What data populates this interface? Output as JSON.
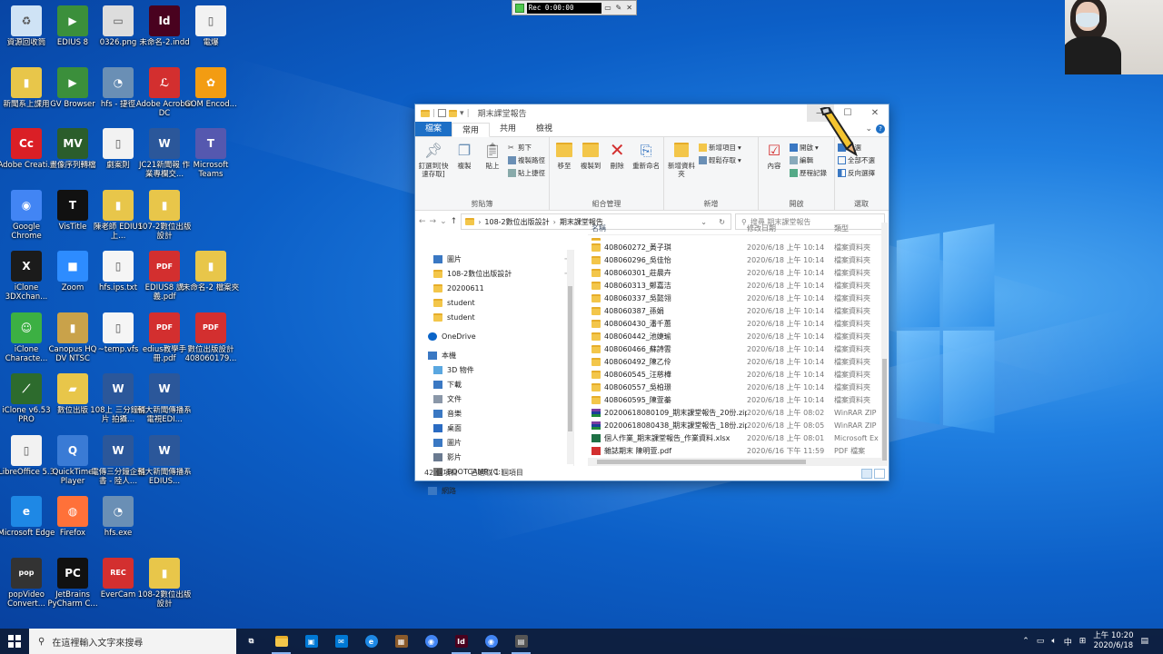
{
  "desktop": {
    "col1": [
      {
        "label": "資源回收筒",
        "icon": "recycle-bin-icon",
        "color": "#cfe3f5",
        "glyph": "♻"
      },
      {
        "label": "新聞系上課用",
        "icon": "folder-doc-icon",
        "color": "#e8c64a",
        "glyph": "▮"
      },
      {
        "label": "Adobe Creati...",
        "icon": "adobe-cc-icon",
        "color": "#da1f26",
        "glyph": "Cc"
      },
      {
        "label": "Google Chrome",
        "icon": "chrome-icon",
        "color": "#4285f4",
        "glyph": "◉"
      },
      {
        "label": "iClone 3DXchan...",
        "icon": "iclone-3dxchange-icon",
        "color": "#1b1b1b",
        "glyph": "X"
      },
      {
        "label": "iClone Characte...",
        "icon": "iclone-character-icon",
        "color": "#3cb043",
        "glyph": "☺"
      },
      {
        "label": "iClone v6.53 PRO",
        "icon": "iclone-pro-icon",
        "color": "#2d6b2d",
        "glyph": "⟋"
      },
      {
        "label": "LibreOffice 5.3",
        "icon": "libreoffice-icon",
        "color": "#f2f2f2",
        "glyph": "▯"
      },
      {
        "label": "Microsoft Edge",
        "icon": "edge-icon",
        "color": "#1e88e5",
        "glyph": "e"
      },
      {
        "label": "popVideo Convert...",
        "icon": "popvideo-icon",
        "color": "#333333",
        "glyph": "pop"
      }
    ],
    "col2": [
      {
        "label": "EDIUS 8",
        "icon": "edius-icon",
        "color": "#3b8f3b",
        "glyph": "▶"
      },
      {
        "label": "GV Browser",
        "icon": "gv-browser-icon",
        "color": "#3b8f3b",
        "glyph": "▶"
      },
      {
        "label": "畫像序列轉檔",
        "icon": "mv-converter-icon",
        "color": "#2b5d2b",
        "glyph": "MV"
      },
      {
        "label": "VisTitle",
        "icon": "vistitle-icon",
        "color": "#111111",
        "glyph": "T"
      },
      {
        "label": "Zoom",
        "icon": "zoom-icon",
        "color": "#2d8cff",
        "glyph": "■"
      },
      {
        "label": "Canopus HQ DV NTSC",
        "icon": "canopus-icon",
        "color": "#c9a24a",
        "glyph": "▮"
      },
      {
        "label": "數位出版",
        "icon": "folder-icon",
        "color": "#e8c64a",
        "glyph": "▰"
      },
      {
        "label": "QuickTime Player",
        "icon": "quicktime-icon",
        "color": "#3a7bd5",
        "glyph": "Q"
      },
      {
        "label": "Firefox",
        "icon": "firefox-icon",
        "color": "#ff7139",
        "glyph": "◍"
      },
      {
        "label": "JetBrains PyCharm C...",
        "icon": "pycharm-icon",
        "color": "#111111",
        "glyph": "PC"
      }
    ],
    "col3": [
      {
        "label": "0326.png",
        "icon": "image-file-icon",
        "color": "#dddddd",
        "glyph": "▭"
      },
      {
        "label": "hfs - 捷徑",
        "icon": "hfs-icon",
        "color": "#6a8fb5",
        "glyph": "◔"
      },
      {
        "label": "劇案則",
        "icon": "doc-file-icon",
        "color": "#f2f2f2",
        "glyph": "▯"
      },
      {
        "label": "陳老師 EDIUS 上...",
        "icon": "folder-doc-icon",
        "color": "#e8c64a",
        "glyph": "▮"
      },
      {
        "label": "hfs.ips.txt",
        "icon": "text-file-icon",
        "color": "#f5f5f5",
        "glyph": "▯"
      },
      {
        "label": "~temp.vfs",
        "icon": "blank-file-icon",
        "color": "#f5f5f5",
        "glyph": "▯"
      },
      {
        "label": "108上 三分鐘影片 拍攝...",
        "icon": "word-file-icon",
        "color": "#2b579a",
        "glyph": "W"
      },
      {
        "label": "電傳三分鐘企畫書 - 陸人...",
        "icon": "word-file-icon",
        "color": "#2b579a",
        "glyph": "W"
      },
      {
        "label": "hfs.exe",
        "icon": "hfs-exe-icon",
        "color": "#6a8fb5",
        "glyph": "◔"
      },
      {
        "label": "EverCam",
        "icon": "evercam-icon",
        "color": "#d32f2f",
        "glyph": "REC"
      }
    ],
    "col4": [
      {
        "label": "未命名-2.indd",
        "icon": "indesign-file-icon",
        "color": "#49021f",
        "glyph": "Id"
      },
      {
        "label": "Adobe Acrobat DC",
        "icon": "acrobat-icon",
        "color": "#d32f2f",
        "glyph": "ℒ"
      },
      {
        "label": "JC21新聞報 作業專欄交...",
        "icon": "word-file-icon",
        "color": "#2b579a",
        "glyph": "W"
      },
      {
        "label": "107-2數位出版設計",
        "icon": "folder-doc-icon",
        "color": "#e8c64a",
        "glyph": "▮"
      },
      {
        "label": "EDIUS8 講義.pdf",
        "icon": "pdf-file-icon",
        "color": "#d32f2f",
        "glyph": "PDF"
      },
      {
        "label": "edius教學手冊.pdf",
        "icon": "pdf-file-icon",
        "color": "#d32f2f",
        "glyph": "PDF"
      },
      {
        "label": "輔大新聞傳播系 電視EDI...",
        "icon": "word-file-icon",
        "color": "#2b579a",
        "glyph": "W"
      },
      {
        "label": "輔大新聞傳播系 EDIUS...",
        "icon": "word-file-icon",
        "color": "#2b579a",
        "glyph": "W"
      },
      {
        "label": "",
        "icon": "empty-slot",
        "color": "transparent",
        "glyph": ""
      },
      {
        "label": "108-2數位出版設計",
        "icon": "folder-doc-icon",
        "color": "#e8c64a",
        "glyph": "▮"
      }
    ],
    "col5": [
      {
        "label": "電爆",
        "icon": "doc-file-icon",
        "color": "#f2f2f2",
        "glyph": "▯"
      },
      {
        "label": "GOM Encod...",
        "icon": "gom-encoder-icon",
        "color": "#f39c12",
        "glyph": "✿"
      },
      {
        "label": "Microsoft Teams",
        "icon": "teams-icon",
        "color": "#5558af",
        "glyph": "T"
      },
      {
        "label": "",
        "icon": "empty-slot",
        "color": "transparent",
        "glyph": ""
      },
      {
        "label": "未命名-2 檔案夾",
        "icon": "folder-doc-icon",
        "color": "#e8c64a",
        "glyph": "▮"
      },
      {
        "label": "數位出版設計 408060179...",
        "icon": "pdf-file-icon",
        "color": "#d32f2f",
        "glyph": "PDF"
      }
    ]
  },
  "recorder": {
    "time": "Rec 0:00:00"
  },
  "explorer": {
    "title": "期末課堂報告",
    "tabs": {
      "file": "檔案",
      "home": "常用",
      "share": "共用",
      "view": "檢視"
    },
    "ribbon": {
      "pin": "釘選到[快速存取]",
      "copy": "複製",
      "paste": "貼上",
      "cut": "剪下",
      "copy_path": "複製路徑",
      "paste_shortcut": "貼上捷徑",
      "clipboard": "剪貼簿",
      "move_to": "移至",
      "copy_to": "複製到",
      "delete": "刪除",
      "rename": "重新命名",
      "organize": "組合管理",
      "new_folder": "新增資料夾",
      "new_item": "新增項目",
      "easy_access": "輕鬆存取",
      "new": "新增",
      "properties": "內容",
      "open": "開啟",
      "edit": "編輯",
      "history": "歷程記錄",
      "open_group": "開啟",
      "select_all": "全選",
      "select_none": "全部不選",
      "invert": "反向選擇",
      "select": "選取"
    },
    "address": {
      "seg1": "108-2數位出版設計",
      "seg2": "期末課堂報告",
      "search_placeholder": "搜尋 期末課堂報告"
    },
    "nav": [
      {
        "label": "圖片",
        "icon": "pictures-icon",
        "pin": true,
        "indent": 0
      },
      {
        "label": "108-2數位出版設計",
        "icon": "folder-icon",
        "pin": true,
        "indent": 0
      },
      {
        "label": "20200611",
        "icon": "folder-icon",
        "pin": false,
        "indent": 0
      },
      {
        "label": "student",
        "icon": "folder-icon",
        "pin": false,
        "indent": 0
      },
      {
        "label": "student",
        "icon": "folder-icon",
        "pin": false,
        "indent": 0
      },
      {
        "label": "",
        "icon": "spacer",
        "pin": false,
        "indent": 0
      },
      {
        "label": "OneDrive",
        "icon": "onedrive-icon",
        "pin": false,
        "indent": -1
      },
      {
        "label": "",
        "icon": "spacer",
        "pin": false,
        "indent": 0
      },
      {
        "label": "本機",
        "icon": "this-pc-icon",
        "pin": false,
        "indent": -1
      },
      {
        "label": "3D 物件",
        "icon": "3d-objects-icon",
        "pin": false,
        "indent": 0
      },
      {
        "label": "下載",
        "icon": "downloads-icon",
        "pin": false,
        "indent": 0
      },
      {
        "label": "文件",
        "icon": "documents-icon",
        "pin": false,
        "indent": 0
      },
      {
        "label": "音樂",
        "icon": "music-icon",
        "pin": false,
        "indent": 0
      },
      {
        "label": "桌面",
        "icon": "desktop-icon",
        "pin": false,
        "indent": 0
      },
      {
        "label": "圖片",
        "icon": "pictures-icon",
        "pin": false,
        "indent": 0
      },
      {
        "label": "影片",
        "icon": "videos-icon",
        "pin": false,
        "indent": 0
      },
      {
        "label": "BOOTCAMP (C:)",
        "icon": "drive-icon",
        "pin": false,
        "indent": 0
      },
      {
        "label": "",
        "icon": "spacer",
        "pin": false,
        "indent": 0
      },
      {
        "label": "網路",
        "icon": "network-icon",
        "pin": false,
        "indent": -1
      }
    ],
    "columns": {
      "name": "名稱",
      "date": "修改日期",
      "type": "類型"
    },
    "files": [
      {
        "name": "408060272_黃子琪",
        "date": "2020/6/18 上午 10:14",
        "type": "檔案資料夾",
        "kind": "folder"
      },
      {
        "name": "408060296_吳佳怡",
        "date": "2020/6/18 上午 10:14",
        "type": "檔案資料夾",
        "kind": "folder"
      },
      {
        "name": "408060301_莊晨卉",
        "date": "2020/6/18 上午 10:14",
        "type": "檔案資料夾",
        "kind": "folder"
      },
      {
        "name": "408060313_鄭嘉洁",
        "date": "2020/6/18 上午 10:14",
        "type": "檔案資料夾",
        "kind": "folder"
      },
      {
        "name": "408060337_吳懿翎",
        "date": "2020/6/18 上午 10:14",
        "type": "檔案資料夾",
        "kind": "folder"
      },
      {
        "name": "408060387_孫娟",
        "date": "2020/6/18 上午 10:14",
        "type": "檔案資料夾",
        "kind": "folder"
      },
      {
        "name": "408060430_潘千蕙",
        "date": "2020/6/18 上午 10:14",
        "type": "檔案資料夾",
        "kind": "folder"
      },
      {
        "name": "408060442_池婕瑜",
        "date": "2020/6/18 上午 10:14",
        "type": "檔案資料夾",
        "kind": "folder"
      },
      {
        "name": "408060466_蘇詩雲",
        "date": "2020/6/18 上午 10:14",
        "type": "檔案資料夾",
        "kind": "folder"
      },
      {
        "name": "408060492_陳乙伶",
        "date": "2020/6/18 上午 10:14",
        "type": "檔案資料夾",
        "kind": "folder"
      },
      {
        "name": "408060545_汪慈樺",
        "date": "2020/6/18 上午 10:14",
        "type": "檔案資料夾",
        "kind": "folder"
      },
      {
        "name": "408060557_吳柏璟",
        "date": "2020/6/18 上午 10:14",
        "type": "檔案資料夾",
        "kind": "folder"
      },
      {
        "name": "408060595_陳萱蓁",
        "date": "2020/6/18 上午 10:14",
        "type": "檔案資料夾",
        "kind": "folder"
      },
      {
        "name": "20200618080109_期末課堂報告_20份.zip",
        "date": "2020/6/18 上午 08:02",
        "type": "WinRAR ZIP",
        "kind": "zip"
      },
      {
        "name": "20200618080438_期末課堂報告_18份.zip",
        "date": "2020/6/18 上午 08:05",
        "type": "WinRAR ZIP",
        "kind": "zip"
      },
      {
        "name": "個人作業_期末課堂報告_作業資料.xlsx",
        "date": "2020/6/18 上午 08:01",
        "type": "Microsoft Ex",
        "kind": "xls"
      },
      {
        "name": "雜誌期末 陳明萱.pdf",
        "date": "2020/6/16 下午 11:59",
        "type": "PDF 檔案",
        "kind": "pdf"
      }
    ],
    "status": {
      "count": "42 個項目",
      "selected": "已選取 1 個項目"
    }
  },
  "taskbar": {
    "search_placeholder": "在這裡輸入文字來搜尋",
    "apps": [
      {
        "icon": "task-view-icon",
        "color": "transparent",
        "glyph": "⧉",
        "running": false
      },
      {
        "icon": "file-explorer-icon",
        "color": "#f3c64a",
        "glyph": "",
        "running": true
      },
      {
        "icon": "store-icon",
        "color": "#0078d4",
        "glyph": "▣",
        "running": false
      },
      {
        "icon": "mail-icon",
        "color": "#0078d4",
        "glyph": "✉",
        "running": false
      },
      {
        "icon": "edge-icon",
        "color": "#1e88e5",
        "glyph": "e",
        "running": false
      },
      {
        "icon": "photo-app-icon",
        "color": "#8a5a2b",
        "glyph": "▦",
        "running": false
      },
      {
        "icon": "chrome-icon",
        "color": "#4285f4",
        "glyph": "◉",
        "running": false
      },
      {
        "icon": "indesign-icon",
        "color": "#49021f",
        "glyph": "Id",
        "running": true
      },
      {
        "icon": "chrome-icon",
        "color": "#4285f4",
        "glyph": "◉",
        "running": true
      },
      {
        "icon": "video-app-icon",
        "color": "#555555",
        "glyph": "▤",
        "running": true
      }
    ],
    "ime": "中",
    "time": "上午 10:20",
    "date": "2020/6/18"
  }
}
